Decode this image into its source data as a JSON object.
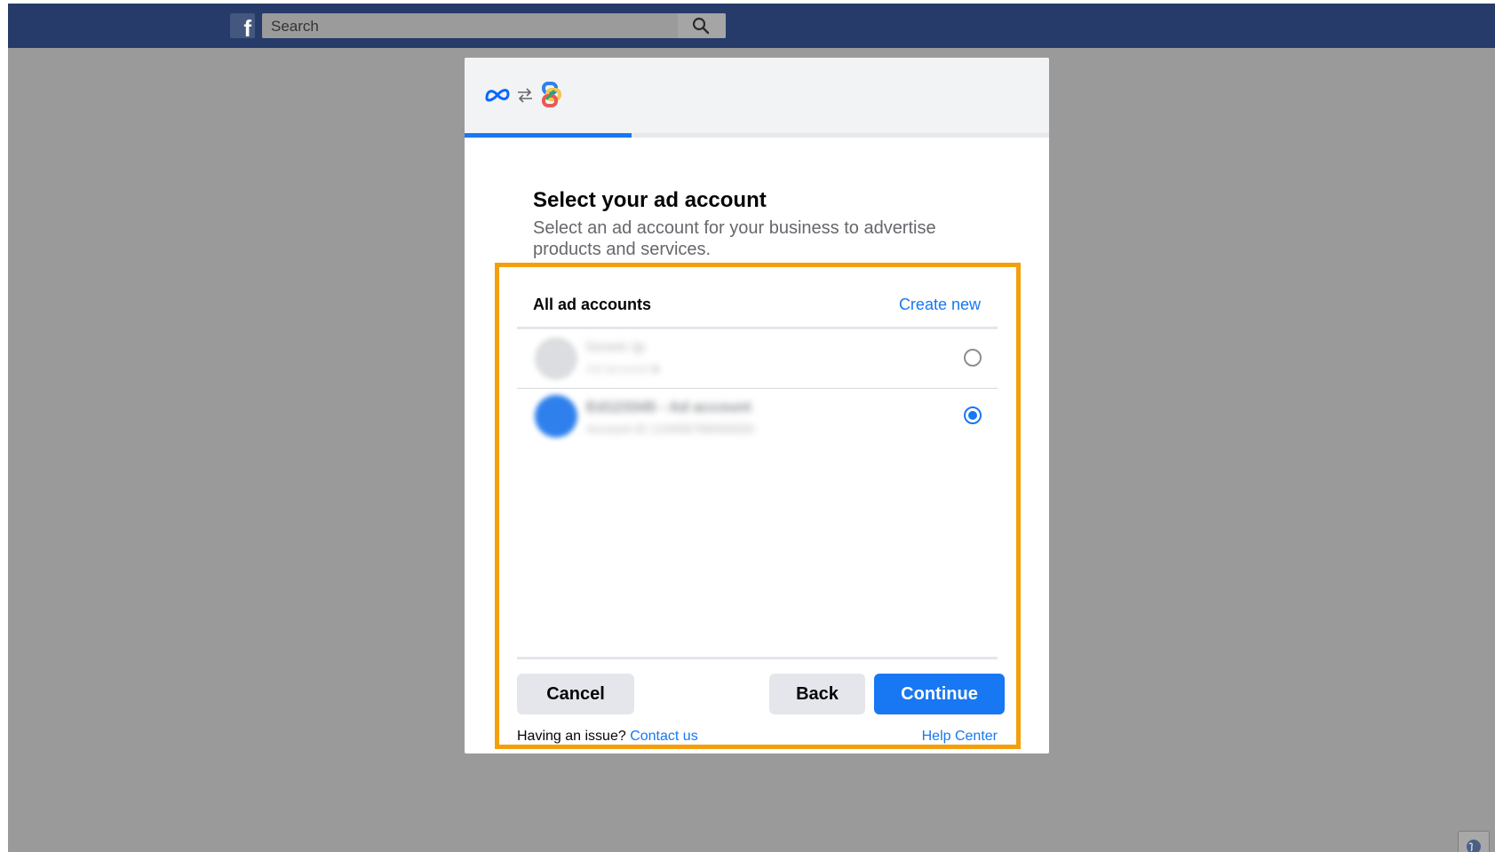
{
  "topbar": {
    "logo_letter": "f",
    "search_placeholder": "Search"
  },
  "dialog": {
    "header_icons": [
      "meta-logo-icon",
      "swap-arrows-icon",
      "app-logo-icon"
    ],
    "progress_fraction": 0.285,
    "title": "Select your ad account",
    "subtitle": "Select an ad account for your business to advertise products and services.",
    "list_header": "All ad accounts",
    "create_new": "Create new",
    "accounts": [
      {
        "name": "lorem ip",
        "sub": "Ad account ■",
        "selected": false
      },
      {
        "name": "Ed123345 - Ad account",
        "sub": "Account ID 123456789000000",
        "selected": true
      }
    ],
    "buttons": {
      "cancel": "Cancel",
      "back": "Back",
      "continue": "Continue"
    },
    "footer": {
      "issue": "Having an issue?",
      "contact": "Contact us",
      "help": "Help Center"
    }
  },
  "colors": {
    "topbar": "#263b69",
    "overlay": "#9a9a9a",
    "accent": "#1877f2",
    "highlight": "#f59e0b"
  }
}
